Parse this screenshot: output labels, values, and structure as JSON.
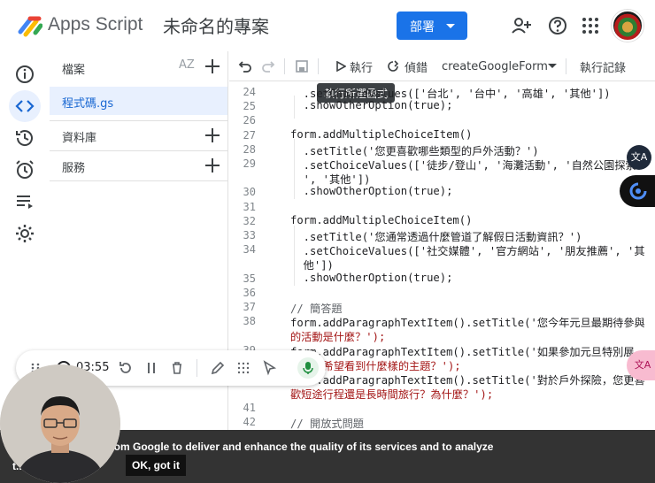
{
  "header": {
    "app_name": "Apps Script",
    "project_title": "未命名的專案",
    "deploy_label": "部署",
    "icons": [
      "add-person-icon",
      "help-icon",
      "apps-grid-icon"
    ]
  },
  "rail": {
    "items": [
      "info-icon",
      "code-icon",
      "history-icon",
      "alarm-icon",
      "executions-icon",
      "settings-icon"
    ],
    "active": "code-icon"
  },
  "files_pane": {
    "title": "檔案",
    "sort_label": "AZ",
    "file_name": "程式碼.gs",
    "sections": [
      "資料庫",
      "服務"
    ]
  },
  "toolbar": {
    "run_label": "執行",
    "debug_label": "偵錯",
    "function_name": "createGoogleForm",
    "log_label": "執行記錄"
  },
  "tooltip": "執行所選函式",
  "code": {
    "line_numbers": [
      "24",
      "25",
      "26",
      "27",
      "28",
      "29",
      "30",
      "31",
      "32",
      "33",
      "34",
      "35",
      "36",
      "37",
      "38",
      "39",
      "40",
      "41",
      "42"
    ],
    "lines": [
      "  .setChoiceValues(['台北', '台中', '高雄', '其他'])",
      "  .showOtherOption(true);",
      "",
      "form.addMultipleChoiceItem()",
      "  .setTitle('您更喜歡哪些類型的戶外活動？')",
      "  .setChoiceValues(['徒步/登山', '海灘活動', '自然公園探索",
      "  ', '其他'])",
      "  .showOtherOption(true);",
      "",
      "form.addMultipleChoiceItem()",
      "  .setTitle('您通常透過什麼管道了解假日活動資訊？')",
      "  .setChoiceValues(['社交媒體', '官方網站', '朋友推薦', '其",
      "  他'])",
      "  .showOtherOption(true);",
      "",
      "// 簡答題",
      "form.addParagraphTextItem().setTitle('您今年元旦最期待參與",
      "的活動是什麼？');",
      "form.addParagraphTextItem().setTitle('如果參加元旦特別展",
      "覽，您希望看到什麼樣的主題？');",
      "form.addParagraphTextItem().setTitle('對於戶外探險，您更喜",
      "歡短途行程還是長時間旅行？為什麼？');",
      "",
      "// 開放式問題"
    ]
  },
  "floating": {
    "translate_label": "文A",
    "translate_label_2": "文A"
  },
  "recorder": {
    "time": "03:55"
  },
  "cookie": {
    "text": "...s from Google to deliver and enhance the quality of its services and to analyze",
    "more": "t... ...ore",
    "ok_label": "OK, got it"
  }
}
